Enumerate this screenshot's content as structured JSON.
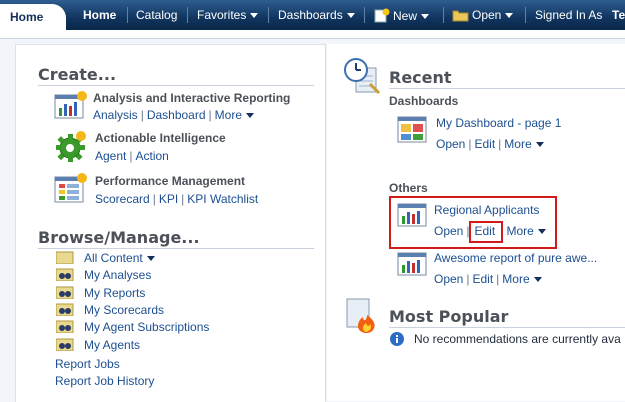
{
  "nav": {
    "home_tab": "Home",
    "home": "Home",
    "catalog": "Catalog",
    "favorites": "Favorites",
    "dashboards": "Dashboards",
    "new": "New",
    "open": "Open",
    "signed_in": "Signed In As",
    "user_initial": "Te"
  },
  "create": {
    "title": "Create...",
    "items": [
      {
        "title": "Analysis and Interactive Reporting",
        "links": [
          "Analysis",
          "Dashboard",
          "More"
        ]
      },
      {
        "title": "Actionable Intelligence",
        "links": [
          "Agent",
          "Action"
        ]
      },
      {
        "title": "Performance Management",
        "links": [
          "Scorecard",
          "KPI",
          "KPI Watchlist"
        ]
      }
    ]
  },
  "browse": {
    "title": "Browse/Manage...",
    "items": [
      "All Content",
      "My Analyses",
      "My Reports",
      "My Scorecards",
      "My Agent Subscriptions",
      "My Agents"
    ],
    "links": [
      "Report Jobs",
      "Report Job History"
    ]
  },
  "recent": {
    "title": "Recent",
    "dashboards_label": "Dashboards",
    "dashboards": [
      {
        "name": "My Dashboard - page 1",
        "actions": [
          "Open",
          "Edit",
          "More"
        ]
      }
    ],
    "others_label": "Others",
    "others": [
      {
        "name": "Regional Applicants",
        "actions": [
          "Open",
          "Edit",
          "More"
        ]
      },
      {
        "name": "Awesome report of pure awe...",
        "actions": [
          "Open",
          "Edit",
          "More"
        ]
      }
    ]
  },
  "popular": {
    "title": "Most Popular",
    "message": "No recommendations are currently ava"
  },
  "colors": {
    "nav_bg": "#10355f",
    "link": "#1d4f91",
    "highlight": "#d11a1a"
  }
}
